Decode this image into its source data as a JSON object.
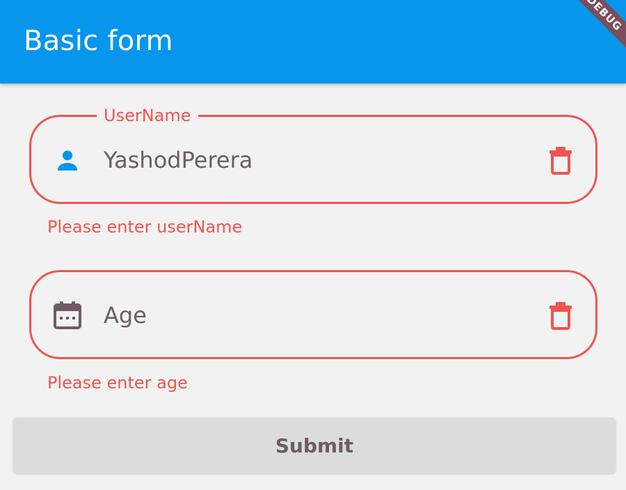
{
  "appbar": {
    "title": "Basic form",
    "debug_banner": "DEBUG",
    "color": "#0796ec"
  },
  "form": {
    "username": {
      "label": "UserName",
      "value": "YashodPerera",
      "icon": "person-icon",
      "trailing_icon": "trash-icon",
      "error": "Please enter userName"
    },
    "age": {
      "placeholder": "Age",
      "icon": "calendar-icon",
      "trailing_icon": "trash-icon",
      "error": "Please enter age"
    },
    "submit_label": "Submit"
  },
  "colors": {
    "error": "#f0544f",
    "accent": "#0796ec",
    "background": "#f2f2f2",
    "button_bg": "#dcdcdc",
    "muted_text": "#6e5c65"
  }
}
